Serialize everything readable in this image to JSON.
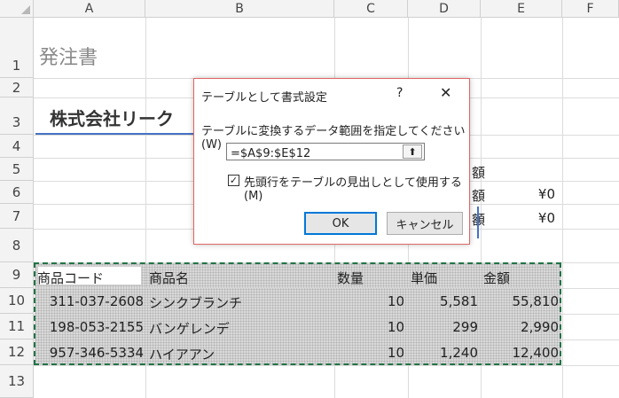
{
  "columns": [
    "A",
    "B",
    "C",
    "D",
    "E",
    "F"
  ],
  "rows": [
    "1",
    "2",
    "3",
    "4",
    "5",
    "6",
    "7",
    "8",
    "9",
    "10",
    "11",
    "12",
    "13"
  ],
  "sheet": {
    "title": "発注書",
    "company": "株式会社リーク",
    "partial_e5": "額",
    "partial_e6": "額",
    "partial_e7": "額",
    "e6_value": "¥0",
    "e7_value": "¥0",
    "headers": [
      "商品コード",
      "商品名",
      "数量",
      "単価",
      "金額"
    ],
    "table_rows": [
      {
        "code": "311-037-2608",
        "name": "シンクブランチ",
        "qty": "10",
        "price": "5,581",
        "amount": "55,810"
      },
      {
        "code": "198-053-2155",
        "name": "バンゲレンデ",
        "qty": "10",
        "price": "299",
        "amount": "2,990"
      },
      {
        "code": "957-346-5334",
        "name": "ハイアアン",
        "qty": "10",
        "price": "1,240",
        "amount": "12,400"
      }
    ]
  },
  "dialog": {
    "title": "テーブルとして書式設定",
    "help": "?",
    "close": "✕",
    "prompt": "テーブルに変換するデータ範囲を指定してください(W)",
    "range_value": "=$A$9:$E$12",
    "collapse_icon": "⬆",
    "checkbox_checked": true,
    "checkbox_mark": "✓",
    "checkbox_label": "先頭行をテーブルの見出しとして使用する(M)",
    "ok_label": "OK",
    "cancel_label": "キャンセル"
  },
  "colors": {
    "marquee": "#217346",
    "accent_blue": "#4472c4",
    "dialog_border": "#e06666",
    "ok_border": "#0078d7"
  }
}
